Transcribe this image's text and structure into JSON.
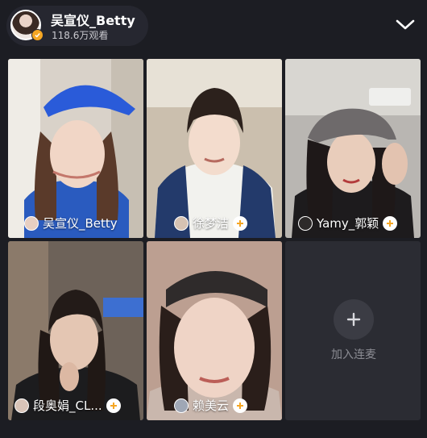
{
  "host": {
    "name": "吴宣仪_Betty",
    "viewers": "118.6万观看"
  },
  "guests": [
    {
      "name": "吴宣仪_Betty",
      "show_follow": false
    },
    {
      "name": "徐梦洁",
      "show_follow": true
    },
    {
      "name": "Yamy_郭颖",
      "show_follow": true
    },
    {
      "name": "段奥娟_CL...",
      "show_follow": true
    },
    {
      "name": "赖美云",
      "show_follow": true
    }
  ],
  "empty_slot": {
    "label": "加入连麦"
  },
  "icons": {
    "collapse": "chevron-down-icon",
    "follow": "plus-icon",
    "join": "plus-icon",
    "verified": "verified-badge-icon"
  },
  "colors": {
    "follow_plus": "#f6a623",
    "verified": "#f5a623"
  }
}
